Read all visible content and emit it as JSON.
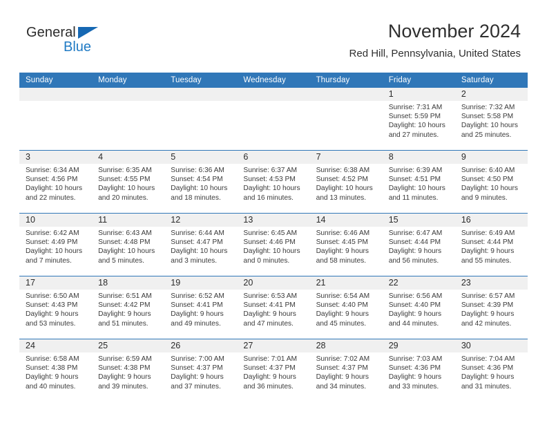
{
  "brand": {
    "name_top": "General",
    "name_bottom": "Blue",
    "triangle_color": "#1668b3",
    "blue_color": "#1f7ac4"
  },
  "header": {
    "title": "November 2024",
    "subtitle": "Red Hill, Pennsylvania, United States"
  },
  "theme": {
    "header_bg": "#3077b8",
    "daynum_bg": "#f0f0f0",
    "cell_bg": "#ffffff",
    "text_color": "#3a3a3a"
  },
  "weekday_headers": [
    "Sunday",
    "Monday",
    "Tuesday",
    "Wednesday",
    "Thursday",
    "Friday",
    "Saturday"
  ],
  "weeks": [
    [
      {
        "day": "",
        "sunrise": "",
        "sunset": "",
        "daylight_1": "",
        "daylight_2": ""
      },
      {
        "day": "",
        "sunrise": "",
        "sunset": "",
        "daylight_1": "",
        "daylight_2": ""
      },
      {
        "day": "",
        "sunrise": "",
        "sunset": "",
        "daylight_1": "",
        "daylight_2": ""
      },
      {
        "day": "",
        "sunrise": "",
        "sunset": "",
        "daylight_1": "",
        "daylight_2": ""
      },
      {
        "day": "",
        "sunrise": "",
        "sunset": "",
        "daylight_1": "",
        "daylight_2": ""
      },
      {
        "day": "1",
        "sunrise": "Sunrise: 7:31 AM",
        "sunset": "Sunset: 5:59 PM",
        "daylight_1": "Daylight: 10 hours",
        "daylight_2": "and 27 minutes."
      },
      {
        "day": "2",
        "sunrise": "Sunrise: 7:32 AM",
        "sunset": "Sunset: 5:58 PM",
        "daylight_1": "Daylight: 10 hours",
        "daylight_2": "and 25 minutes."
      }
    ],
    [
      {
        "day": "3",
        "sunrise": "Sunrise: 6:34 AM",
        "sunset": "Sunset: 4:56 PM",
        "daylight_1": "Daylight: 10 hours",
        "daylight_2": "and 22 minutes."
      },
      {
        "day": "4",
        "sunrise": "Sunrise: 6:35 AM",
        "sunset": "Sunset: 4:55 PM",
        "daylight_1": "Daylight: 10 hours",
        "daylight_2": "and 20 minutes."
      },
      {
        "day": "5",
        "sunrise": "Sunrise: 6:36 AM",
        "sunset": "Sunset: 4:54 PM",
        "daylight_1": "Daylight: 10 hours",
        "daylight_2": "and 18 minutes."
      },
      {
        "day": "6",
        "sunrise": "Sunrise: 6:37 AM",
        "sunset": "Sunset: 4:53 PM",
        "daylight_1": "Daylight: 10 hours",
        "daylight_2": "and 16 minutes."
      },
      {
        "day": "7",
        "sunrise": "Sunrise: 6:38 AM",
        "sunset": "Sunset: 4:52 PM",
        "daylight_1": "Daylight: 10 hours",
        "daylight_2": "and 13 minutes."
      },
      {
        "day": "8",
        "sunrise": "Sunrise: 6:39 AM",
        "sunset": "Sunset: 4:51 PM",
        "daylight_1": "Daylight: 10 hours",
        "daylight_2": "and 11 minutes."
      },
      {
        "day": "9",
        "sunrise": "Sunrise: 6:40 AM",
        "sunset": "Sunset: 4:50 PM",
        "daylight_1": "Daylight: 10 hours",
        "daylight_2": "and 9 minutes."
      }
    ],
    [
      {
        "day": "10",
        "sunrise": "Sunrise: 6:42 AM",
        "sunset": "Sunset: 4:49 PM",
        "daylight_1": "Daylight: 10 hours",
        "daylight_2": "and 7 minutes."
      },
      {
        "day": "11",
        "sunrise": "Sunrise: 6:43 AM",
        "sunset": "Sunset: 4:48 PM",
        "daylight_1": "Daylight: 10 hours",
        "daylight_2": "and 5 minutes."
      },
      {
        "day": "12",
        "sunrise": "Sunrise: 6:44 AM",
        "sunset": "Sunset: 4:47 PM",
        "daylight_1": "Daylight: 10 hours",
        "daylight_2": "and 3 minutes."
      },
      {
        "day": "13",
        "sunrise": "Sunrise: 6:45 AM",
        "sunset": "Sunset: 4:46 PM",
        "daylight_1": "Daylight: 10 hours",
        "daylight_2": "and 0 minutes."
      },
      {
        "day": "14",
        "sunrise": "Sunrise: 6:46 AM",
        "sunset": "Sunset: 4:45 PM",
        "daylight_1": "Daylight: 9 hours",
        "daylight_2": "and 58 minutes."
      },
      {
        "day": "15",
        "sunrise": "Sunrise: 6:47 AM",
        "sunset": "Sunset: 4:44 PM",
        "daylight_1": "Daylight: 9 hours",
        "daylight_2": "and 56 minutes."
      },
      {
        "day": "16",
        "sunrise": "Sunrise: 6:49 AM",
        "sunset": "Sunset: 4:44 PM",
        "daylight_1": "Daylight: 9 hours",
        "daylight_2": "and 55 minutes."
      }
    ],
    [
      {
        "day": "17",
        "sunrise": "Sunrise: 6:50 AM",
        "sunset": "Sunset: 4:43 PM",
        "daylight_1": "Daylight: 9 hours",
        "daylight_2": "and 53 minutes."
      },
      {
        "day": "18",
        "sunrise": "Sunrise: 6:51 AM",
        "sunset": "Sunset: 4:42 PM",
        "daylight_1": "Daylight: 9 hours",
        "daylight_2": "and 51 minutes."
      },
      {
        "day": "19",
        "sunrise": "Sunrise: 6:52 AM",
        "sunset": "Sunset: 4:41 PM",
        "daylight_1": "Daylight: 9 hours",
        "daylight_2": "and 49 minutes."
      },
      {
        "day": "20",
        "sunrise": "Sunrise: 6:53 AM",
        "sunset": "Sunset: 4:41 PM",
        "daylight_1": "Daylight: 9 hours",
        "daylight_2": "and 47 minutes."
      },
      {
        "day": "21",
        "sunrise": "Sunrise: 6:54 AM",
        "sunset": "Sunset: 4:40 PM",
        "daylight_1": "Daylight: 9 hours",
        "daylight_2": "and 45 minutes."
      },
      {
        "day": "22",
        "sunrise": "Sunrise: 6:56 AM",
        "sunset": "Sunset: 4:40 PM",
        "daylight_1": "Daylight: 9 hours",
        "daylight_2": "and 44 minutes."
      },
      {
        "day": "23",
        "sunrise": "Sunrise: 6:57 AM",
        "sunset": "Sunset: 4:39 PM",
        "daylight_1": "Daylight: 9 hours",
        "daylight_2": "and 42 minutes."
      }
    ],
    [
      {
        "day": "24",
        "sunrise": "Sunrise: 6:58 AM",
        "sunset": "Sunset: 4:38 PM",
        "daylight_1": "Daylight: 9 hours",
        "daylight_2": "and 40 minutes."
      },
      {
        "day": "25",
        "sunrise": "Sunrise: 6:59 AM",
        "sunset": "Sunset: 4:38 PM",
        "daylight_1": "Daylight: 9 hours",
        "daylight_2": "and 39 minutes."
      },
      {
        "day": "26",
        "sunrise": "Sunrise: 7:00 AM",
        "sunset": "Sunset: 4:37 PM",
        "daylight_1": "Daylight: 9 hours",
        "daylight_2": "and 37 minutes."
      },
      {
        "day": "27",
        "sunrise": "Sunrise: 7:01 AM",
        "sunset": "Sunset: 4:37 PM",
        "daylight_1": "Daylight: 9 hours",
        "daylight_2": "and 36 minutes."
      },
      {
        "day": "28",
        "sunrise": "Sunrise: 7:02 AM",
        "sunset": "Sunset: 4:37 PM",
        "daylight_1": "Daylight: 9 hours",
        "daylight_2": "and 34 minutes."
      },
      {
        "day": "29",
        "sunrise": "Sunrise: 7:03 AM",
        "sunset": "Sunset: 4:36 PM",
        "daylight_1": "Daylight: 9 hours",
        "daylight_2": "and 33 minutes."
      },
      {
        "day": "30",
        "sunrise": "Sunrise: 7:04 AM",
        "sunset": "Sunset: 4:36 PM",
        "daylight_1": "Daylight: 9 hours",
        "daylight_2": "and 31 minutes."
      }
    ]
  ]
}
